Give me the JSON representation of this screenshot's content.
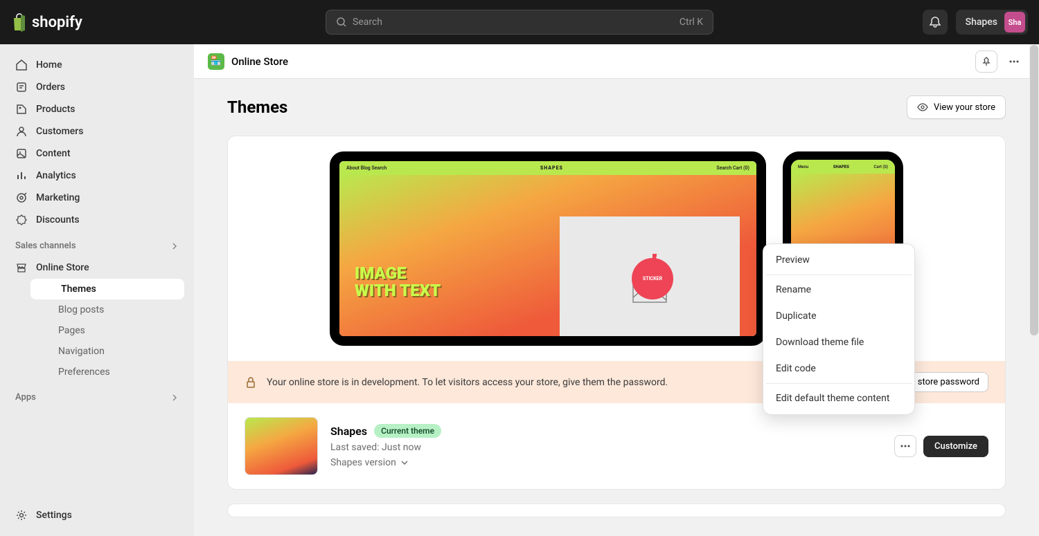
{
  "brand": "shopify",
  "search": {
    "placeholder": "Search",
    "kbd": "Ctrl K"
  },
  "store_name": "Shapes",
  "avatar_initials": "Sha",
  "nav": {
    "home": "Home",
    "orders": "Orders",
    "products": "Products",
    "customers": "Customers",
    "content": "Content",
    "analytics": "Analytics",
    "marketing": "Marketing",
    "discounts": "Discounts"
  },
  "sections": {
    "sales_channels": "Sales channels",
    "apps": "Apps"
  },
  "online_store": {
    "label": "Online Store",
    "sub": {
      "themes": "Themes",
      "blog_posts": "Blog posts",
      "pages": "Pages",
      "navigation": "Navigation",
      "preferences": "Preferences"
    }
  },
  "settings_label": "Settings",
  "breadcrumb": "Online Store",
  "page_title": "Themes",
  "view_store": "View your store",
  "mock": {
    "desktop_nav_left": "About   Blog   Search",
    "desktop_logo": "SHAPES",
    "desktop_nav_right": "Search   Cart (0)",
    "headline_l1": "IMAGE",
    "headline_l2": "WITH TEXT",
    "sticker": "STICKER",
    "mobile_left": "Menu",
    "mobile_logo": "SHAPES",
    "mobile_right": "Cart (0)"
  },
  "notice": {
    "text": "Your online store is in development. To let visitors access your store, give them the password.",
    "button": "Manage store password"
  },
  "theme": {
    "name": "Shapes",
    "badge": "Current theme",
    "saved": "Last saved: Just now",
    "version": "Shapes version"
  },
  "customize": "Customize",
  "dropdown": {
    "preview": "Preview",
    "rename": "Rename",
    "duplicate": "Duplicate",
    "download": "Download theme file",
    "edit_code": "Edit code",
    "edit_default": "Edit default theme content"
  }
}
